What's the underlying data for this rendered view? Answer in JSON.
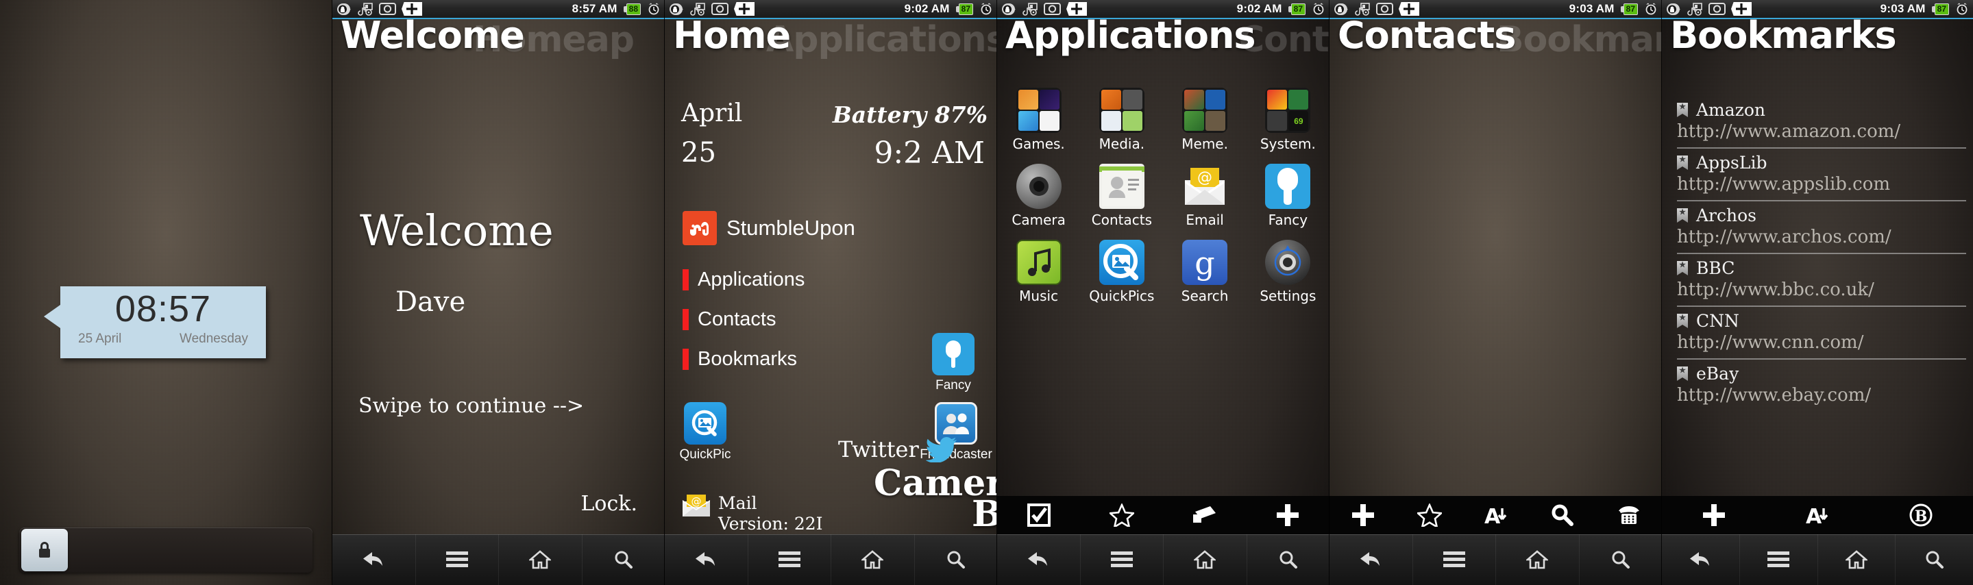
{
  "panels": {
    "lock": {
      "status": {
        "time": "8:57 AM",
        "battery": "88"
      },
      "clock": {
        "time": "08:57",
        "date": "25 April",
        "weekday": "Wednesday"
      },
      "lock_hint": "slide-to-unlock"
    },
    "welcome": {
      "header": "Welcome",
      "header_ghost": "Homeap",
      "status": {
        "time": "8:57 AM",
        "battery": "88"
      },
      "title": "Welcome",
      "name": "Dave",
      "swipe": "Swipe to continue -->",
      "lock_label": "Lock."
    },
    "home": {
      "header": "Home",
      "header_ghost": "Applications",
      "status": {
        "time": "9:02 AM",
        "battery": "87"
      },
      "month": "April",
      "day": "25",
      "battery_text": "Battery 87%",
      "clock": "9:2 AM",
      "stumbleupon": "StumbleUpon",
      "menu": [
        "Applications",
        "Contacts",
        "Bookmarks"
      ],
      "shortcuts": [
        {
          "label": "Fancy",
          "icon": "fancy-icon"
        },
        {
          "label": "QuickPic",
          "icon": "quickpic-icon"
        },
        {
          "label": "Friendcaster",
          "icon": "friendcaster-icon"
        }
      ],
      "twitter": "Twitter",
      "camera": "Camera",
      "browser": "Browser",
      "mail": "Mail",
      "mail_version": "Version: 22I"
    },
    "apps": {
      "header": "Applications",
      "header_ghost": "Contacts",
      "status": {
        "time": "9:02 AM",
        "battery": "87"
      },
      "grid": [
        {
          "label": "Games.",
          "type": "folder",
          "icon": "games-folder-icon"
        },
        {
          "label": "Media.",
          "type": "folder",
          "icon": "media-folder-icon"
        },
        {
          "label": "Meme.",
          "type": "folder",
          "icon": "meme-folder-icon"
        },
        {
          "label": "System.",
          "type": "folder",
          "icon": "system-folder-icon",
          "badge": "69"
        },
        {
          "label": "Camera",
          "type": "app",
          "icon": "camera-icon"
        },
        {
          "label": "Contacts",
          "type": "app",
          "icon": "contacts-icon"
        },
        {
          "label": "Email",
          "type": "app",
          "icon": "email-icon"
        },
        {
          "label": "Fancy",
          "type": "app",
          "icon": "fancy-icon"
        },
        {
          "label": "Music",
          "type": "app",
          "icon": "music-icon"
        },
        {
          "label": "QuickPics",
          "type": "app",
          "icon": "quickpic-icon"
        },
        {
          "label": "Search",
          "type": "app",
          "icon": "google-search-icon"
        },
        {
          "label": "Settings",
          "type": "app",
          "icon": "settings-icon"
        }
      ],
      "actionbar": [
        "check-box-icon",
        "star-icon",
        "camera-flip-icon",
        "plus-icon"
      ]
    },
    "contacts": {
      "header": "Contacts",
      "header_ghost": "Bookmarks",
      "status": {
        "time": "9:03 AM",
        "battery": "87"
      },
      "actionbar": [
        "plus-icon",
        "star-icon",
        "sort-az-icon",
        "search-icon",
        "phone-icon"
      ]
    },
    "bookmarks": {
      "header": "Bookmarks",
      "status": {
        "time": "9:03 AM",
        "battery": "87"
      },
      "items": [
        {
          "title": "Amazon",
          "url": "http://www.amazon.com/"
        },
        {
          "title": "AppsLib",
          "url": "http://www.appslib.com"
        },
        {
          "title": "Archos",
          "url": "http://www.archos.com/"
        },
        {
          "title": "BBC",
          "url": "http://www.bbc.co.uk/"
        },
        {
          "title": "CNN",
          "url": "http://www.cnn.com/"
        },
        {
          "title": "eBay",
          "url": "http://www.ebay.com/"
        }
      ],
      "actionbar": [
        "plus-icon",
        "sort-az-icon",
        "bookmark-b-icon"
      ]
    }
  },
  "navbar": [
    "back-icon",
    "menu-icon",
    "home-icon",
    "search-icon"
  ],
  "statusbar_icons": [
    "lock-icon",
    "media-sync-icon",
    "screenshot-icon"
  ],
  "colors": {
    "accent_blue": "#3aa7d8",
    "menu_red": "#f41f1f",
    "stumbleupon_orange": "#eb4924",
    "battery_green": "#5bbd12",
    "clock_widget_blue": "#c3dae8"
  }
}
